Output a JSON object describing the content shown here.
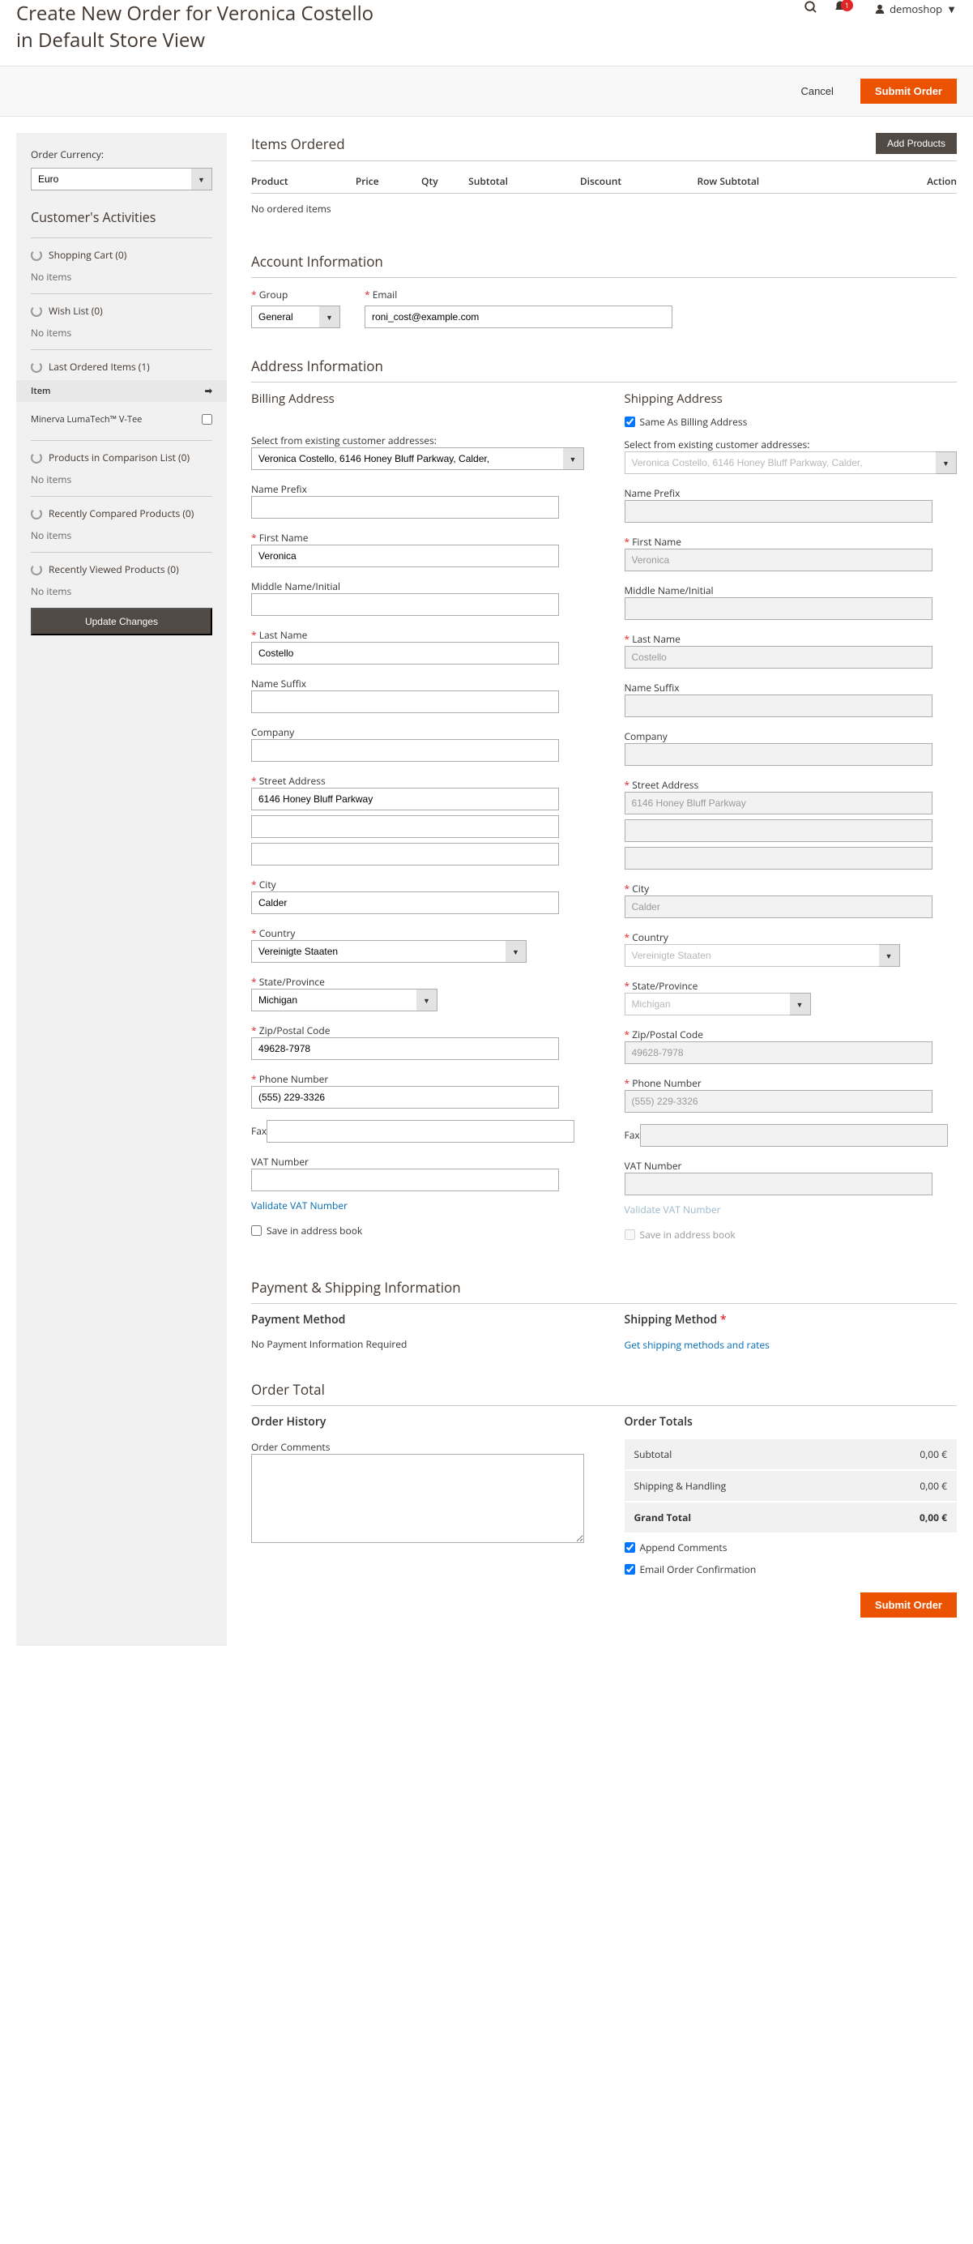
{
  "header": {
    "title": "Create New Order for Veronica Costello in Default Store View",
    "user": "demoshop",
    "badge": "1"
  },
  "toolbar": {
    "cancel": "Cancel",
    "submit": "Submit Order"
  },
  "sidebar": {
    "currency_label": "Order Currency:",
    "currency_value": "Euro",
    "activities_title": "Customer's Activities",
    "shopping_cart": "Shopping Cart (0)",
    "wish_list": "Wish List (0)",
    "last_ordered": "Last Ordered Items (1)",
    "item_header": "Item",
    "last_item": "Minerva LumaTech™ V-Tee",
    "comparison": "Products in Comparison List (0)",
    "recently_compared": "Recently Compared Products (0)",
    "recently_viewed": "Recently Viewed Products (0)",
    "no_items": "No items",
    "update": "Update Changes"
  },
  "items": {
    "title": "Items Ordered",
    "add": "Add Products",
    "cols": {
      "product": "Product",
      "price": "Price",
      "qty": "Qty",
      "subtotal": "Subtotal",
      "discount": "Discount",
      "row_subtotal": "Row Subtotal",
      "action": "Action"
    },
    "empty": "No ordered items"
  },
  "account": {
    "title": "Account Information",
    "group_label": "Group",
    "group_value": "General",
    "email_label": "Email",
    "email_value": "roni_cost@example.com"
  },
  "address": {
    "title": "Address Information",
    "billing": "Billing Address",
    "shipping": "Shipping Address",
    "same_as": "Same As Billing Address",
    "select_existing": "Select from existing customer addresses:",
    "existing_value": "Veronica Costello, 6146 Honey Bluff Parkway, Calder,",
    "prefix": "Name Prefix",
    "first": "First Name",
    "middle": "Middle Name/Initial",
    "last": "Last Name",
    "suffix": "Name Suffix",
    "company": "Company",
    "street": "Street Address",
    "city": "City",
    "country": "Country",
    "state": "State/Province",
    "zip": "Zip/Postal Code",
    "phone": "Phone Number",
    "fax": "Fax",
    "vat": "VAT Number",
    "validate": "Validate VAT Number",
    "save": "Save in address book",
    "v": {
      "first": "Veronica",
      "last": "Costello",
      "street1": "6146 Honey Bluff Parkway",
      "city": "Calder",
      "country": "Vereinigte Staaten",
      "state": "Michigan",
      "zip": "49628-7978",
      "phone": "(555) 229-3326"
    }
  },
  "payship": {
    "title": "Payment & Shipping Information",
    "pay_title": "Payment Method",
    "pay_msg": "No Payment Information Required",
    "ship_title": "Shipping Method",
    "ship_link": "Get shipping methods and rates"
  },
  "total": {
    "title": "Order Total",
    "history": "Order History",
    "comments": "Order Comments",
    "totals": "Order Totals",
    "subtotal": "Subtotal",
    "shipping": "Shipping & Handling",
    "grand": "Grand Total",
    "zero": "0,00 €",
    "append": "Append Comments",
    "confirm": "Email Order Confirmation",
    "submit": "Submit Order"
  }
}
